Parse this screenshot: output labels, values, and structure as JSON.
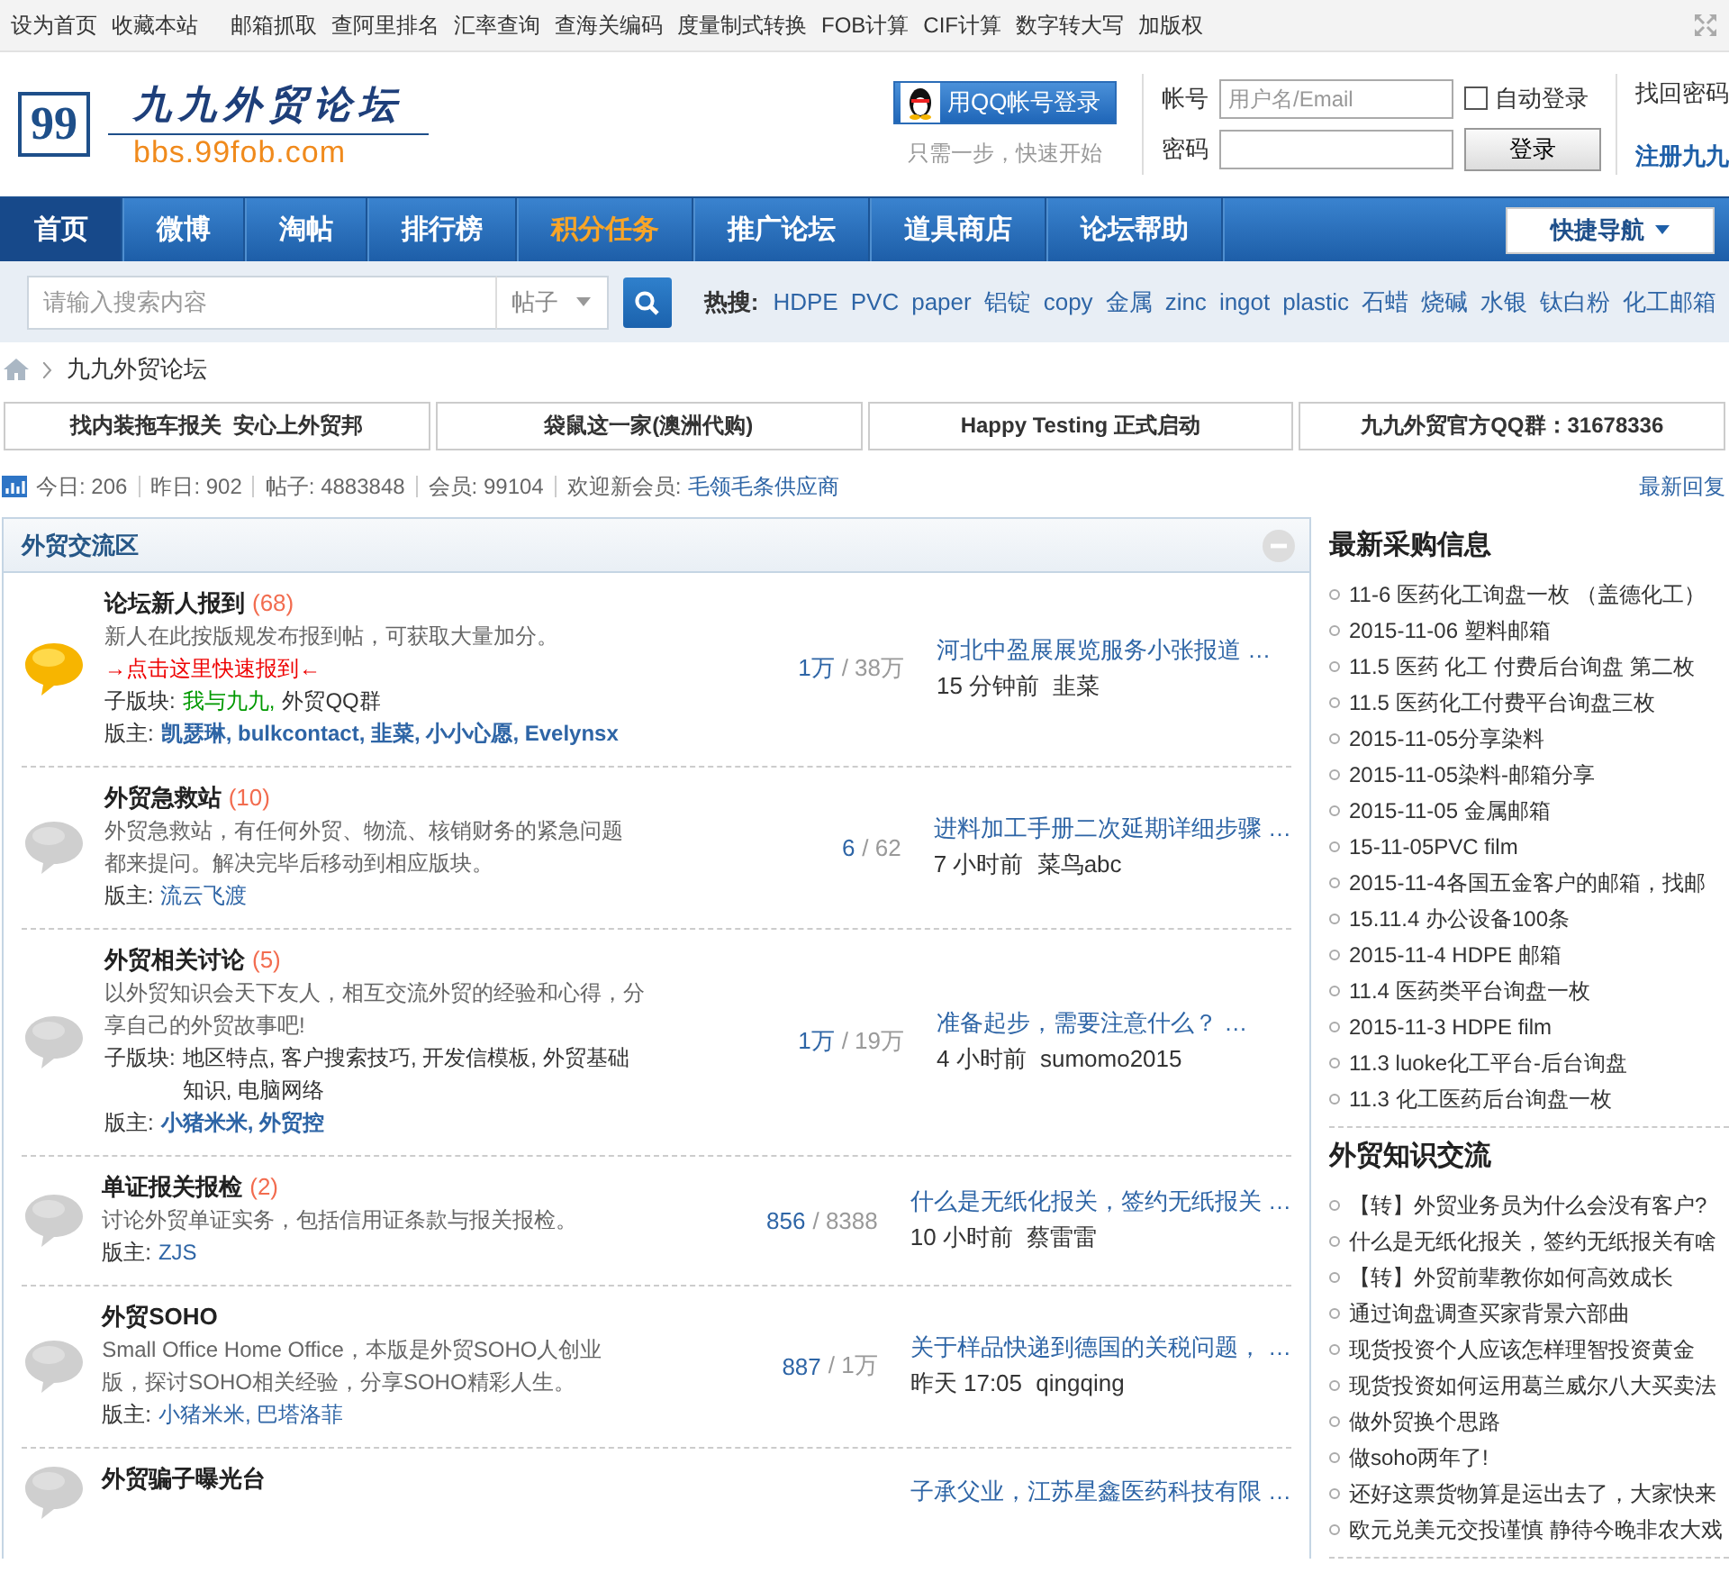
{
  "top_bar": {
    "site_links": [
      "设为首页",
      "收藏本站"
    ],
    "tools": [
      "邮箱抓取",
      "查阿里排名",
      "汇率查询",
      "查海关编码",
      "度量制式转换",
      "FOB计算",
      "CIF计算",
      "数字转大写",
      "加版权"
    ]
  },
  "header": {
    "logo": {
      "badge": "99",
      "title": "九九外贸论坛",
      "url": "bbs.99fob.com"
    },
    "qq_login": {
      "button": "用QQ帐号登录",
      "hint": "只需一步，快速开始"
    },
    "login": {
      "account_label": "帐号",
      "account_placeholder": "用户名/Email",
      "password_label": "密码",
      "auto_login": {
        "label": "自动登录",
        "checked": false
      },
      "submit": "登录",
      "forgot": "找回密码",
      "register": "注册九九"
    }
  },
  "nav": {
    "items": [
      {
        "label": "首页",
        "selected": true,
        "kind": "normal"
      },
      {
        "label": "微博",
        "selected": false,
        "kind": "normal"
      },
      {
        "label": "淘帖",
        "selected": false,
        "kind": "normal"
      },
      {
        "label": "排行榜",
        "selected": false,
        "kind": "normal"
      },
      {
        "label": "积分任务",
        "selected": false,
        "kind": "highlight"
      },
      {
        "label": "推广论坛",
        "selected": false,
        "kind": "normal"
      },
      {
        "label": "道具商店",
        "selected": false,
        "kind": "normal"
      },
      {
        "label": "论坛帮助",
        "selected": false,
        "kind": "normal"
      }
    ],
    "quick_nav": "快捷导航"
  },
  "search": {
    "placeholder": "请输入搜索内容",
    "scope": "帖子",
    "hot_label": "热搜:",
    "hot_terms": [
      "HDPE",
      "PVC",
      "paper",
      "铝锭",
      "copy",
      "金属",
      "zinc",
      "ingot",
      "plastic",
      "石蜡",
      "烧碱",
      "水银",
      "钛白粉",
      "化工邮箱"
    ]
  },
  "breadcrumb": [
    "九九外贸论坛"
  ],
  "announcements": [
    "找内装拖车报关  安心上外贸邦",
    "袋鼠这一家(澳洲代购)",
    "Happy Testing 正式启动",
    "九九外贸官方QQ群：31678336"
  ],
  "stats": {
    "items": [
      "今日: 206",
      "昨日: 902",
      "帖子: 4883848",
      "会员: 99104"
    ],
    "welcome_label": "欢迎新会员:",
    "new_member": "毛领毛条供应商",
    "latest_link": "最新回复"
  },
  "forum": {
    "title": "外贸交流区",
    "rows": [
      {
        "title": "论坛新人报到",
        "today": "(68)",
        "has_new": true,
        "description": "新人在此按版规发布报到帖，可获取大量加分。",
        "promo": "→点击这里快速报到←",
        "subforum_label": "子版块:",
        "subforums": [
          {
            "name": "我与九九,",
            "color": "#009900"
          },
          {
            "name": "外贸QQ群",
            "color": "#333333"
          }
        ],
        "moderator_label": "版主:",
        "moderators": {
          "names": "凯瑟琳, bulkcontact, 韭菜, 小小心愿, Evelynsx",
          "bold": true
        },
        "threads": "1万",
        "posts": "/ 38万",
        "last_post": {
          "title": "河北中盈展展览服务小张报道 …",
          "time": "15 分钟前",
          "user": "韭菜"
        }
      },
      {
        "title": "外贸急救站",
        "today": "(10)",
        "has_new": false,
        "description": "外贸急救站，有任何外贸、物流、核销财务的紧急问题都来提问。解决完毕后移动到相应版块。",
        "moderator_label": "版主:",
        "moderators": {
          "names": "流云飞渡",
          "bold": false
        },
        "threads": "6",
        "posts": "/ 62",
        "last_post": {
          "title": "进料加工手册二次延期详细步骤 …",
          "time": "7 小时前",
          "user": "菜鸟abc"
        }
      },
      {
        "title": "外贸相关讨论",
        "today": "(5)",
        "has_new": false,
        "description": "以外贸知识会天下友人，相互交流外贸的经验和心得，分享自己的外贸故事吧!",
        "subforum_label": "子版块:",
        "subforums": [
          {
            "name": "地区特点, 客户搜索技巧, 开发信模板, 外贸基础知识, 电脑网络",
            "color": "#333333"
          }
        ],
        "moderator_label": "版主:",
        "moderators": {
          "names": "小猪米米, 外贸控",
          "bold": true
        },
        "threads": "1万",
        "posts": "/ 19万",
        "last_post": {
          "title": "准备起步，需要注意什么？ …",
          "time": "4 小时前",
          "user": "sumomo2015"
        }
      },
      {
        "title": "单证报关报检",
        "today": "(2)",
        "has_new": false,
        "description": "讨论外贸单证实务，包括信用证条款与报关报检。",
        "moderator_label": "版主:",
        "moderators": {
          "names": "ZJS",
          "bold": false
        },
        "threads": "856",
        "posts": "/ 8388",
        "last_post": {
          "title": "什么是无纸化报关，签约无纸报关 …",
          "time": "10 小时前",
          "user": "蔡雷雷"
        }
      },
      {
        "title": "外贸SOHO",
        "has_new": false,
        "description": "Small Office Home Office，本版是外贸SOHO人创业版，探讨SOHO相关经验，分享SOHO精彩人生。",
        "moderator_label": "版主:",
        "moderators": {
          "names": "小猪米米, 巴塔洛菲",
          "bold": false
        },
        "threads": "887",
        "posts": "/ 1万",
        "last_post": {
          "title": "关于样品快递到德国的关税问题， …",
          "time": "昨天 17:05",
          "user": "qingqing"
        }
      },
      {
        "title": "外贸骗子曝光台",
        "has_new": false,
        "last_post": {
          "title": "子承父业，江苏星鑫医药科技有限 …"
        }
      }
    ]
  },
  "sidebar": [
    {
      "title": "最新采购信息",
      "items": [
        "11-6 医药化工询盘一枚 （盖德化工）",
        "2015-11-06 塑料邮箱",
        "11.5 医药  化工  付费后台询盘  第二枚",
        "11.5 医药化工付费平台询盘三枚",
        "2015-11-05分享染料",
        "2015-11-05染料-邮箱分享",
        "2015-11-05 金属邮箱",
        "15-11-05PVC film",
        "2015-11-4各国五金客户的邮箱，找邮",
        "15.11.4 办公设备100条",
        "2015-11-4 HDPE 邮箱",
        "11.4 医药类平台询盘一枚",
        "2015-11-3 HDPE film",
        "11.3 luoke化工平台-后台询盘",
        "11.3 化工医药后台询盘一枚"
      ]
    },
    {
      "title": "外贸知识交流",
      "items": [
        "【转】外贸业务员为什么会没有客户?",
        "什么是无纸化报关，签约无纸报关有啥",
        "【转】外贸前辈教你如何高效成长",
        "通过询盘调查买家背景六部曲",
        "现货投资个人应该怎样理智投资黄金",
        "现货投资如何运用葛兰威尔八大买卖法",
        "做外贸换个思路",
        "做soho两年了!",
        "还好这票货物算是运出去了，大家快来",
        "欧元兑美元交投谨慎 静待今晚非农大戏"
      ]
    }
  ]
}
